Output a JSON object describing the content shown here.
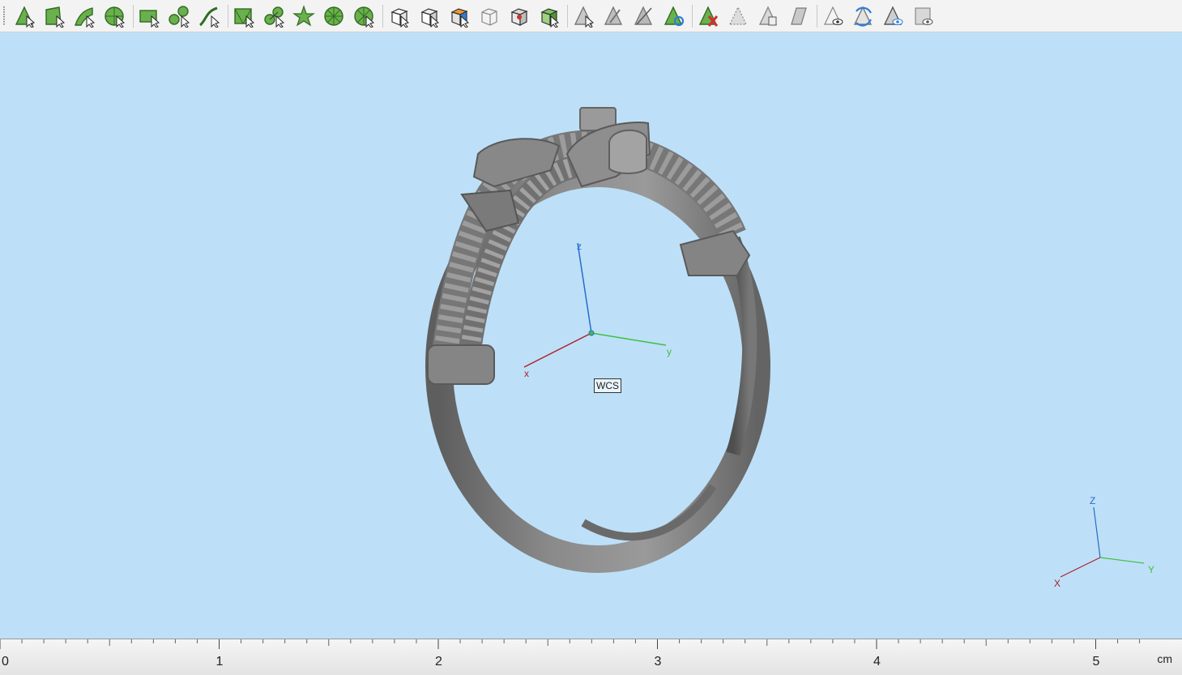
{
  "toolbar": {
    "groups": [
      {
        "group": "selection-modes",
        "icons": [
          "select-vertex-icon",
          "select-face-icon",
          "select-edge-icon",
          "select-solid-icon"
        ]
      },
      {
        "group": "curve-tools",
        "icons": [
          "rectangle-tool-icon",
          "spline-tool-icon",
          "curve-tool-icon"
        ]
      },
      {
        "group": "mesh-tools",
        "icons": [
          "mesh-select-icon",
          "mesh-vertex-icon",
          "mesh-star-icon",
          "mesh-wheel-icon",
          "mesh-radial-icon"
        ]
      },
      {
        "group": "view-cubes",
        "icons": [
          "view-cube-white-icon",
          "view-cube-front-icon",
          "view-cube-orange-icon",
          "view-cube-wire-icon",
          "view-cube-red-icon",
          "view-cube-green-icon"
        ]
      },
      {
        "group": "object-tools",
        "icons": [
          "object-arrow-icon",
          "object-arrow-alt-icon",
          "object-arrow-grey-icon",
          "object-refresh-icon"
        ]
      },
      {
        "group": "edit-tools",
        "icons": [
          "delete-object-icon",
          "hide-object-icon",
          "copy-object-icon",
          "object-edit-icon"
        ]
      },
      {
        "group": "visibility-tools",
        "icons": [
          "show-object-icon",
          "swap-visibility-icon",
          "eye-object-icon",
          "frame-object-icon"
        ]
      }
    ]
  },
  "viewport": {
    "background_color": "#bde0f8",
    "model_color": "#7b7b7b",
    "wcs": {
      "label": "WCS",
      "axes": {
        "x": "x",
        "y": "y",
        "z": "z"
      },
      "colors": {
        "x": "#b0202a",
        "y": "#3fbf3f",
        "z": "#2a6acb"
      }
    },
    "orientation_gizmo": {
      "axes": {
        "x": "X",
        "y": "Y",
        "z": "Z"
      }
    }
  },
  "ruler": {
    "labels": [
      "0",
      "1",
      "2",
      "3",
      "4",
      "5"
    ],
    "unit": "cm"
  }
}
